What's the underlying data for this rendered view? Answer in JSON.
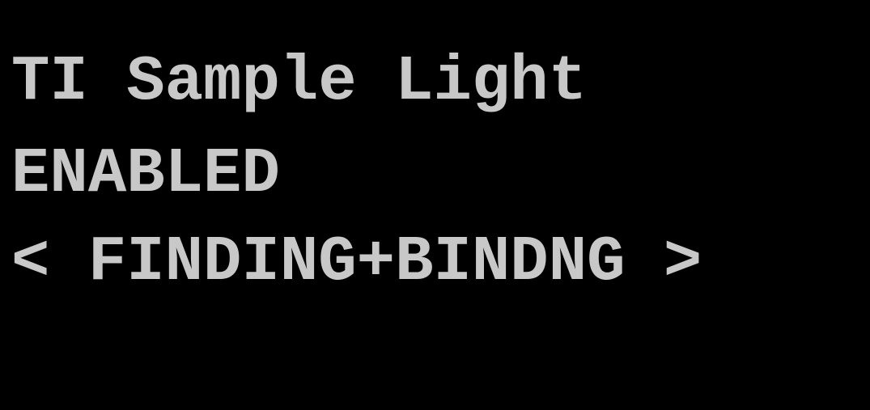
{
  "display": {
    "title": "TI Sample Light",
    "status": "ENABLED",
    "menu_option": "< FINDING+BINDNG >"
  },
  "colors": {
    "background": "#000000",
    "text": "#c8c8c8"
  }
}
